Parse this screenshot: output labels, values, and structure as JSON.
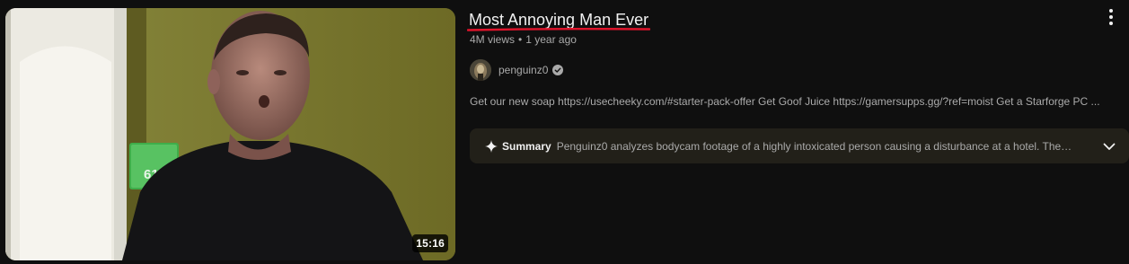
{
  "video": {
    "title": "Most Annoying Man Ever",
    "views": "4M views",
    "age": "1 year ago",
    "duration": "15:16",
    "thumbnail_sign_text": "61"
  },
  "channel": {
    "name": "penguinz0",
    "verified": true
  },
  "description": "Get our new soap https://usecheeky.com/#starter-pack-offer Get Goof Juice https://gamersupps.gg/?ref=moist Get a Starforge PC ...",
  "summary": {
    "label": "Summary",
    "text": "Penguinz0 analyzes bodycam footage of a highly intoxicated person causing a disturbance at a hotel. The…"
  },
  "colors": {
    "background": "#0f0f0f",
    "title_underline": "#e0142b",
    "summary_bg": "#222019",
    "secondary_text": "#aaaaaa"
  },
  "icons": {
    "more": "more-vert-icon",
    "verified": "verified-check-icon",
    "summary": "sparkle-icon",
    "expand": "chevron-down-icon"
  }
}
